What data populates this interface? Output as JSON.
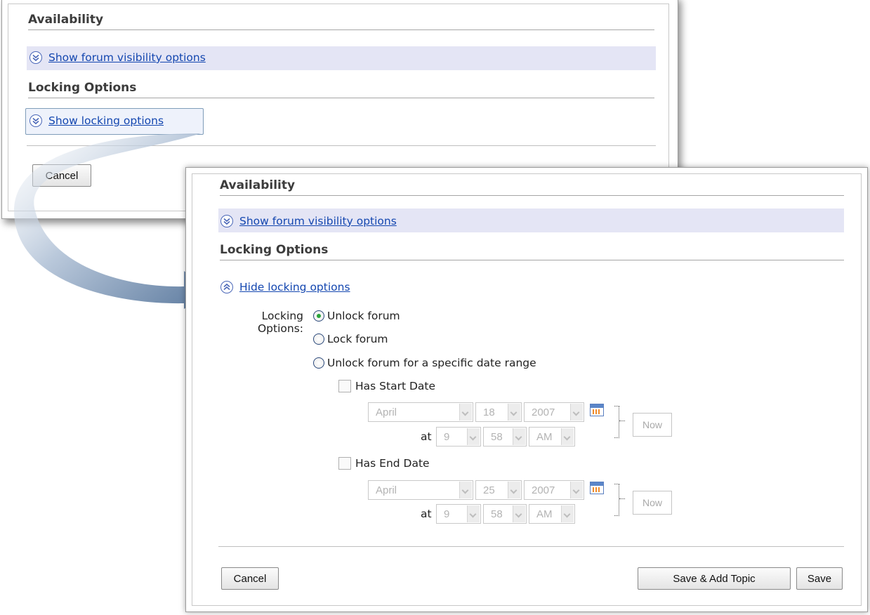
{
  "back_panel": {
    "availability_heading": "Availability",
    "visibility_toggle": "Show forum visibility options",
    "locking_heading": "Locking Options",
    "locking_toggle": "Show locking options",
    "cancel_label": "Cancel"
  },
  "front_panel": {
    "availability_heading": "Availability",
    "visibility_toggle": "Show forum visibility options",
    "locking_heading": "Locking Options",
    "locking_toggle": "Hide locking options",
    "locking_options_label_line1": "Locking",
    "locking_options_label_line2": "Options:",
    "radio_options": [
      {
        "label": "Unlock forum",
        "checked": true
      },
      {
        "label": "Lock forum",
        "checked": false
      },
      {
        "label": "Unlock forum for a specific date range",
        "checked": false
      }
    ],
    "start_date": {
      "checkbox_label": "Has Start Date",
      "checked": false,
      "month": "April",
      "day": "18",
      "year": "2007",
      "at_label": "at",
      "hour": "9",
      "minute": "58",
      "ampm": "AM",
      "now_label": "Now"
    },
    "end_date": {
      "checkbox_label": "Has End Date",
      "checked": false,
      "month": "April",
      "day": "25",
      "year": "2007",
      "at_label": "at",
      "hour": "9",
      "minute": "58",
      "ampm": "AM",
      "now_label": "Now"
    },
    "cancel_label": "Cancel",
    "save_add_topic_label": "Save & Add Topic",
    "save_label": "Save"
  },
  "icons": {
    "expand": "double-chevron-down-icon",
    "collapse": "double-chevron-up-icon",
    "calendar": "calendar-icon"
  },
  "colors": {
    "link": "#1447b0",
    "highlight_row": "#e4e5f5",
    "radio_selected": "#2aa43a"
  }
}
